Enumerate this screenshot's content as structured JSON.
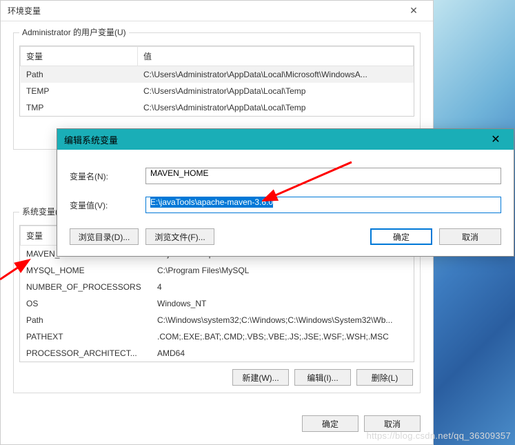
{
  "main_window": {
    "title": "环境变量",
    "user_group_label": "Administrator 的用户变量(U)",
    "sys_group_label": "系统变量(S)",
    "col_var": "变量",
    "col_val": "值",
    "user_vars": [
      {
        "name": "Path",
        "value": "C:\\Users\\Administrator\\AppData\\Local\\Microsoft\\WindowsA..."
      },
      {
        "name": "TEMP",
        "value": "C:\\Users\\Administrator\\AppData\\Local\\Temp"
      },
      {
        "name": "TMP",
        "value": "C:\\Users\\Administrator\\AppData\\Local\\Temp"
      }
    ],
    "sys_vars": [
      {
        "name": "MAVEN_HOME",
        "value": "E:\\javaTools\\apache-maven-3.6.0"
      },
      {
        "name": "MYSQL_HOME",
        "value": "C:\\Program Files\\MySQL"
      },
      {
        "name": "NUMBER_OF_PROCESSORS",
        "value": "4"
      },
      {
        "name": "OS",
        "value": "Windows_NT"
      },
      {
        "name": "Path",
        "value": "C:\\Windows\\system32;C:\\Windows;C:\\Windows\\System32\\Wb..."
      },
      {
        "name": "PATHEXT",
        "value": ".COM;.EXE;.BAT;.CMD;.VBS;.VBE;.JS;.JSE;.WSF;.WSH;.MSC"
      },
      {
        "name": "PROCESSOR_ARCHITECT...",
        "value": "AMD64"
      }
    ],
    "btn_new": "新建(W)...",
    "btn_edit": "编辑(I)...",
    "btn_delete": "删除(L)",
    "btn_ok": "确定",
    "btn_cancel": "取消"
  },
  "edit_dialog": {
    "title": "编辑系统变量",
    "name_label": "变量名(N):",
    "value_label": "变量值(V):",
    "name_value": "MAVEN_HOME",
    "value_value": "E:\\javaTools\\apache-maven-3.6.0",
    "btn_browse_dir": "浏览目录(D)...",
    "btn_browse_file": "浏览文件(F)...",
    "btn_ok": "确定",
    "btn_cancel": "取消"
  },
  "watermark": "https://blog.csdn.net/qq_36309357"
}
